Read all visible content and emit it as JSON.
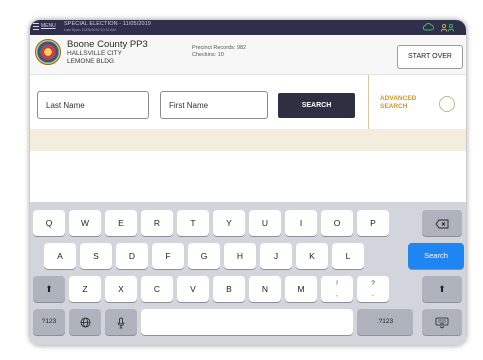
{
  "topbar": {
    "menu_label": "MENU",
    "election_title": "SPECIAL ELECTION - 11/05/2019",
    "election_sub": "Last Sync: 11/05/2019 10:14 AM"
  },
  "header": {
    "county": "Boone County PP3",
    "city": "HALLSVILLE CITY",
    "building": "LEMONE BLDG",
    "precinct_records": "Precinct Records: 982",
    "checkins": "Checkins: 10",
    "start_over_label": "START OVER"
  },
  "search": {
    "last_name_placeholder": "Last Name",
    "first_name_placeholder": "First Name",
    "search_label": "SEARCH",
    "advanced_label_line1": "ADVANCED",
    "advanced_label_line2": "SEARCH"
  },
  "keyboard": {
    "row1": [
      "Q",
      "W",
      "E",
      "R",
      "T",
      "Y",
      "U",
      "I",
      "O",
      "P"
    ],
    "row2": [
      "A",
      "S",
      "D",
      "F",
      "G",
      "H",
      "J",
      "K",
      "L"
    ],
    "row3": [
      "Z",
      "X",
      "C",
      "V",
      "B",
      "N",
      "M"
    ],
    "row3_punct1": "!\n,",
    "row3_punct2": "?\n.",
    "search_key": "Search",
    "numbers_key": "?123",
    "numbers_key_right": ".?123"
  },
  "colors": {
    "topbar": "#2e2f4a",
    "search_button": "#2e3042",
    "advanced_accent": "#c79a2a",
    "beige_bar": "#f4ecdc",
    "keyboard_bg": "#d2d5dc",
    "search_key": "#1f85f2"
  }
}
